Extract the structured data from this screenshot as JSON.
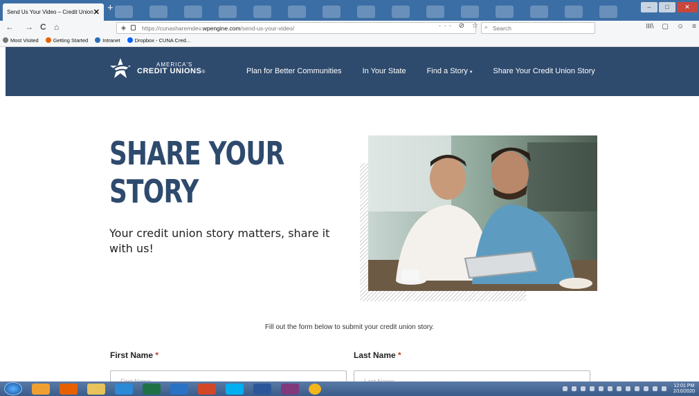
{
  "browser": {
    "tab_title": "Send Us Your Video – Credit Union",
    "close_tab": "✕",
    "new_tab": "+",
    "window_min": "–",
    "window_max": "□",
    "window_close": "✕",
    "back": "←",
    "forward": "→",
    "reload": "C",
    "home": "⌂",
    "url_prefix": "https://cunasharemdev.",
    "url_domain": "wpengine.com",
    "url_path": "/send-us-your-video/",
    "url_actions": "··· ⊘ ☆",
    "search_placeholder": "Search",
    "search_icon": "⌕",
    "toolbar_right": [
      "III\\",
      "▢",
      "☺",
      "≡"
    ]
  },
  "bookmarks": [
    {
      "label": "Most Visited",
      "color": "#777777"
    },
    {
      "label": "Getting Started",
      "color": "#e66000"
    },
    {
      "label": "Intranet",
      "color": "#2a6ebb"
    },
    {
      "label": "Dropbox - CUNA Cred...",
      "color": "#0061ff"
    }
  ],
  "site": {
    "logo_top": "AMERICA'S",
    "logo_bottom": "CREDIT UNIONS",
    "logo_mark": "®",
    "menu": [
      "Plan for Better Communities",
      "In Your State",
      "Find a Story",
      "Share Your Credit Union Story"
    ],
    "menu_caret": "▾",
    "brand_color": "#2e4a6d"
  },
  "hero": {
    "title_line1": "SHARE YOUR",
    "title_line2": "STORY",
    "subtitle": "Your credit union story matters, share it with us!"
  },
  "form": {
    "intro": "Fill out the form below to submit your credit union story.",
    "first_name_label": "First Name",
    "last_name_label": "Last Name",
    "required_mark": "*",
    "first_name_placeholder": "First Name",
    "last_name_placeholder": "Last Name"
  },
  "taskbar": {
    "apps": [
      {
        "name": "windows-explorer",
        "color": "#f0a030"
      },
      {
        "name": "firefox",
        "color": "#e66000"
      },
      {
        "name": "file-explorer",
        "color": "#e8c25a"
      },
      {
        "name": "internet-explorer",
        "color": "#2b8ad6"
      },
      {
        "name": "excel",
        "color": "#1e7145"
      },
      {
        "name": "outlook",
        "color": "#2a72c4"
      },
      {
        "name": "powerpoint",
        "color": "#d24726"
      },
      {
        "name": "skype",
        "color": "#00aff0"
      },
      {
        "name": "word",
        "color": "#2b579a"
      },
      {
        "name": "onenote",
        "color": "#80397b"
      },
      {
        "name": "chrome",
        "color": "#f2b51c"
      }
    ],
    "time": "12:01 PM",
    "date": "2/10/2020"
  }
}
